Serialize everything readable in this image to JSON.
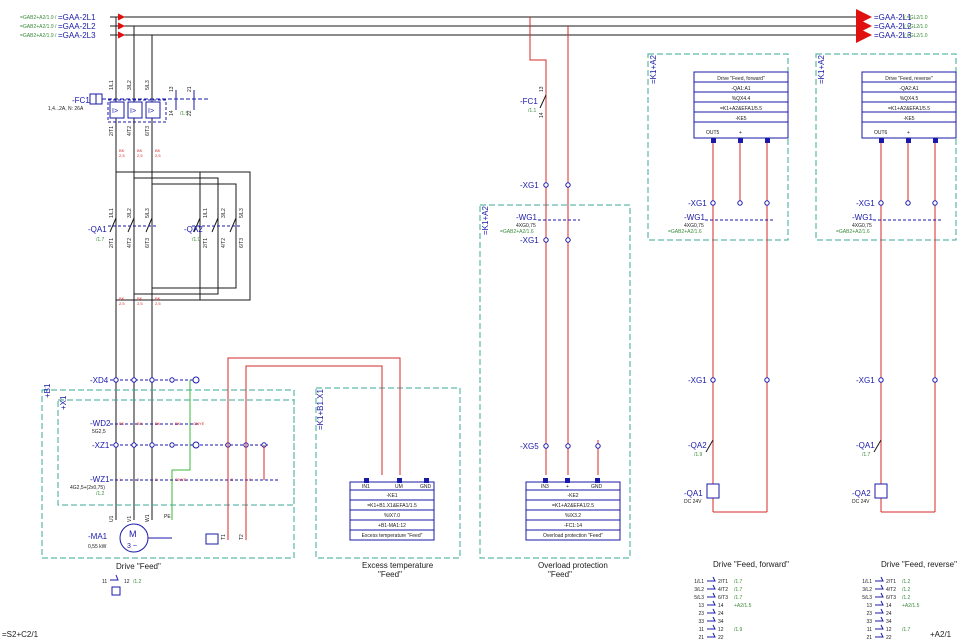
{
  "busbars": [
    {
      "ref": "=GAB2+A2/1.9 /",
      "name": "=GAA-2L1",
      "ref_right": "/ =GL2/1.0"
    },
    {
      "ref": "=GAB2+A2/1.9 /",
      "name": "=GAA-2L2",
      "ref_right": "/ =GL2/1.0"
    },
    {
      "ref": "=GAB2+A2/1.9 /",
      "name": "=GAA-2L3",
      "ref_right": "/ =GL2/1.0"
    }
  ],
  "fc1": {
    "name": "-FC1",
    "rating": "1,4...2A, N: 26A",
    "terminals_top": [
      "1/L1",
      "3/L2",
      "5/L3",
      "13",
      "21"
    ],
    "terminals_bottom": [
      "2/T1",
      "4/T2",
      "6/T3",
      "14",
      "22"
    ],
    "ref": "/1.5"
  },
  "qa1": {
    "name": "-QA1",
    "ref": "/1.7",
    "terminals_top": [
      "1/L1",
      "3/L2",
      "5/L3"
    ],
    "terminals_bottom": [
      "2/T1",
      "4/T2",
      "6/T3"
    ]
  },
  "qa2": {
    "name": "-QA2",
    "ref": "/1.9",
    "terminals_top": [
      "1/L1",
      "3/L2",
      "5/L3"
    ],
    "terminals_bottom": [
      "2/T1",
      "4/T2",
      "6/T3"
    ]
  },
  "wire_labels": [
    "BK",
    "2,5",
    "BK",
    "2,5",
    "BK",
    "2,5"
  ],
  "location_b1": "+B1",
  "location_x1": "+X1",
  "xd4": {
    "name": "-XD4",
    "terminals": [
      "1",
      "2",
      "3",
      "4",
      "PE"
    ]
  },
  "wd2": {
    "name": "-WD2",
    "spec": "5G2,5",
    "cores": [
      "BK",
      "BK",
      "BK",
      "BK",
      "GNYE"
    ]
  },
  "xz1": {
    "name": "-XZ1",
    "terminals": [
      "1",
      "2",
      "3",
      "4",
      "PE"
    ]
  },
  "wz1": {
    "name": "-WZ1",
    "spec": "4G2,5+(2x0,75)",
    "ref": "/1.2",
    "cores": [
      "1",
      "2",
      "3",
      "GNYE",
      "5",
      "6"
    ]
  },
  "ma1": {
    "name": "-MA1",
    "power": "0,55 kW",
    "symbol": "M",
    "phase": "3 ~",
    "terminals": [
      "U1",
      "V1",
      "W1",
      "PE"
    ]
  },
  "motor_temp": {
    "terminals": [
      "T1",
      "T2"
    ]
  },
  "loc_k1b1": "=K1+B1.X1",
  "loc_k1a2": "=K1+A2",
  "temp_module": {
    "terminals": [
      "3",
      "3",
      "3"
    ],
    "labels": [
      "IN1",
      "UM",
      "GND"
    ],
    "rows": [
      "-KE1",
      "=K1+B1.X1&EFA1/1.5",
      "%IX7.0",
      "+B1-MA1:12",
      "Excess temperature \"Feed\""
    ]
  },
  "overload_module": {
    "terminals": [
      "3",
      "3",
      "3"
    ],
    "labels": [
      "IN3",
      "+",
      "GND"
    ],
    "rows": [
      "-KE2",
      "=K1+A2&EFA1/2.5",
      "%IX3.2",
      "-FC1:14",
      "Overload protection \"Feed\""
    ]
  },
  "fc1_contact": {
    "name": "-FC1",
    "ref": "/1.1",
    "t_top": "13",
    "t_bottom": "14"
  },
  "xg1": {
    "name": "-XG1"
  },
  "wg1": {
    "name": "-WG1",
    "spec": "4XG0,75",
    "ref": "=GAB2+A2/1.6"
  },
  "xg5": {
    "name": "-XG5"
  },
  "fwd_module": {
    "rows": [
      "Drive \"Feed, forward\"",
      "-QA1:A1",
      "%QX4.4",
      "=K1+A2&EFA1/5.5",
      "-KE5"
    ],
    "outputs": [
      "OUT5",
      "+"
    ]
  },
  "rev_module": {
    "rows": [
      "Drive \"Feed, reverse\"",
      "-QA2:A1",
      "%QX4.5",
      "=K1+A2&EFA1/5.5",
      "-KE5"
    ],
    "outputs": [
      "OUT6",
      "+"
    ]
  },
  "coil_qa1": {
    "name": "-QA1",
    "spec": "DC 24V",
    "interlock": "-QA2",
    "interlock_ref": "/1.9"
  },
  "coil_qa2": {
    "name": "-QA2",
    "spec": "DC 24V",
    "interlock": "-QA1",
    "interlock_ref": "/1.7"
  },
  "contact_table_fwd": [
    [
      "1/L1",
      "2/T1",
      "/1.7"
    ],
    [
      "3/L2",
      "4/T2",
      "/1.7"
    ],
    [
      "5/L3",
      "6/T3",
      "/1.7"
    ],
    [
      "13",
      "14",
      "+A2/1.5"
    ],
    [
      "23",
      "24",
      ""
    ],
    [
      "33",
      "34",
      ""
    ],
    [
      "11",
      "12",
      "/1.9"
    ],
    [
      "21",
      "22",
      ""
    ]
  ],
  "contact_table_rev": [
    [
      "1/L1",
      "2/T1",
      "/1.2"
    ],
    [
      "3/L2",
      "4/T2",
      "/1.2"
    ],
    [
      "5/L3",
      "6/T3",
      "/1.2"
    ],
    [
      "13",
      "14",
      "+A2/1.5"
    ],
    [
      "23",
      "24",
      ""
    ],
    [
      "33",
      "34",
      ""
    ],
    [
      "11",
      "12",
      "/1.7"
    ],
    [
      "21",
      "22",
      ""
    ]
  ],
  "aux_contact": {
    "t1": "11",
    "t2": "12",
    "ref": "/1.2"
  },
  "captions": {
    "drive": "Drive \"Feed\"",
    "excess1": "Excess temperature",
    "excess2": "\"Feed\"",
    "overload1": "Overload protection",
    "overload2": "\"Feed\"",
    "fwd": "Drive \"Feed, forward\"",
    "rev": "Drive \"Feed, reverse\""
  },
  "footer": {
    "left": "=S2+C2/1",
    "right": "+A2/1"
  },
  "colors": {
    "wire_black": "#1a1a1a",
    "wire_red": "#d42a2a",
    "wire_green": "#3cb83c",
    "symbol_blue": "#1a1aaa",
    "box_teal": "#3aa89a",
    "ref_green": "#3a8a3a",
    "arrow_red": "#e01010"
  }
}
